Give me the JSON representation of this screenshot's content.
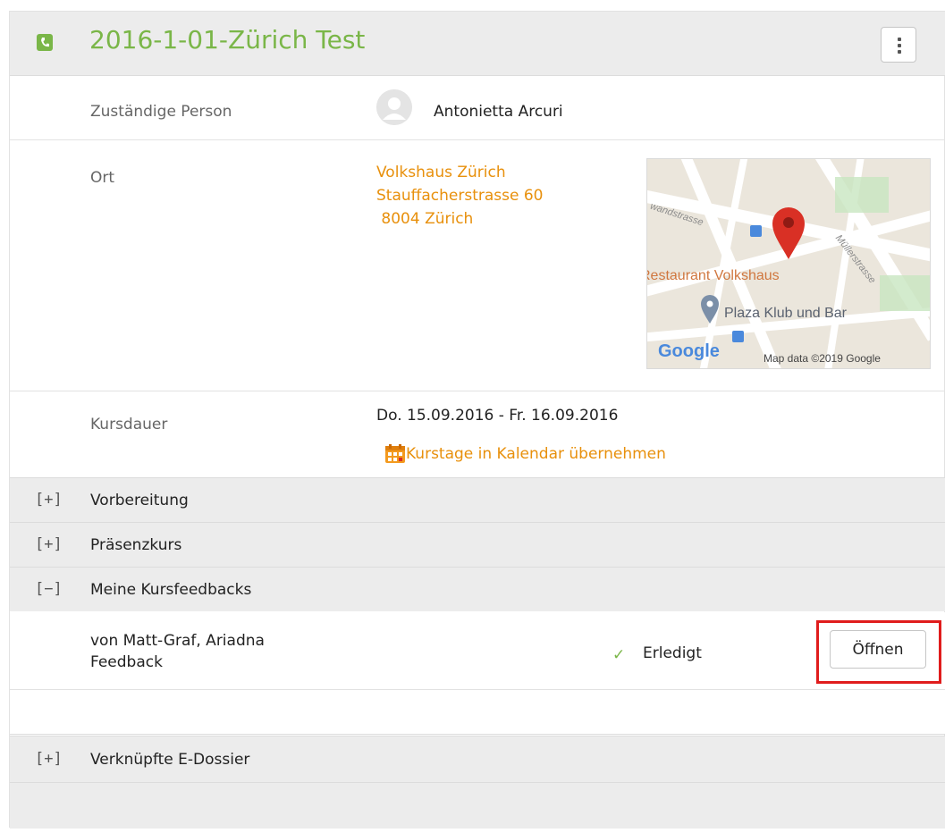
{
  "header": {
    "title": "2016-1-01-Zürich Test"
  },
  "details": {
    "person_label": "Zuständige Person",
    "person_name": "Antonietta Arcuri",
    "location_label": "Ort",
    "address": [
      "Volkshaus Zürich",
      "Stauffacherstrasse 60",
      " 8004 Zürich"
    ],
    "duration_label": "Kursdauer",
    "date_range": "Do. 15.09.2016 - Fr. 16.09.2016",
    "calendar_link": "Kurstage in Kalendar übernehmen"
  },
  "map": {
    "street_1": "wandstrasse",
    "street_2": "Müllerstrasse",
    "poi_1": "Restaurant Volkshaus",
    "poi_2": "Plaza Klub und Bar",
    "logo": "Google",
    "attribution": "Map data ©2019 Google"
  },
  "sections": [
    {
      "toggle": "[+]",
      "label": "Vorbereitung"
    },
    {
      "toggle": "[+]",
      "label": "Präsenzkurs"
    },
    {
      "toggle": "[−]",
      "label": "Meine Kursfeedbacks"
    },
    {
      "toggle": "[+]",
      "label": "Verknüpfte E-Dossier"
    }
  ],
  "feedback": {
    "line1": "von Matt-Graf, Ariadna",
    "line2": "Feedback",
    "status": "Erledigt",
    "open_label": "Öffnen"
  },
  "colors": {
    "accent_green": "#7ab648",
    "link_orange": "#e8900c",
    "highlight_red": "#e01c1c"
  },
  "icons": {
    "course": "course-phone-icon",
    "menu": "kebab-menu-icon",
    "calendar": "calendar-icon",
    "check": "check-icon",
    "avatar": "user-avatar-icon"
  }
}
